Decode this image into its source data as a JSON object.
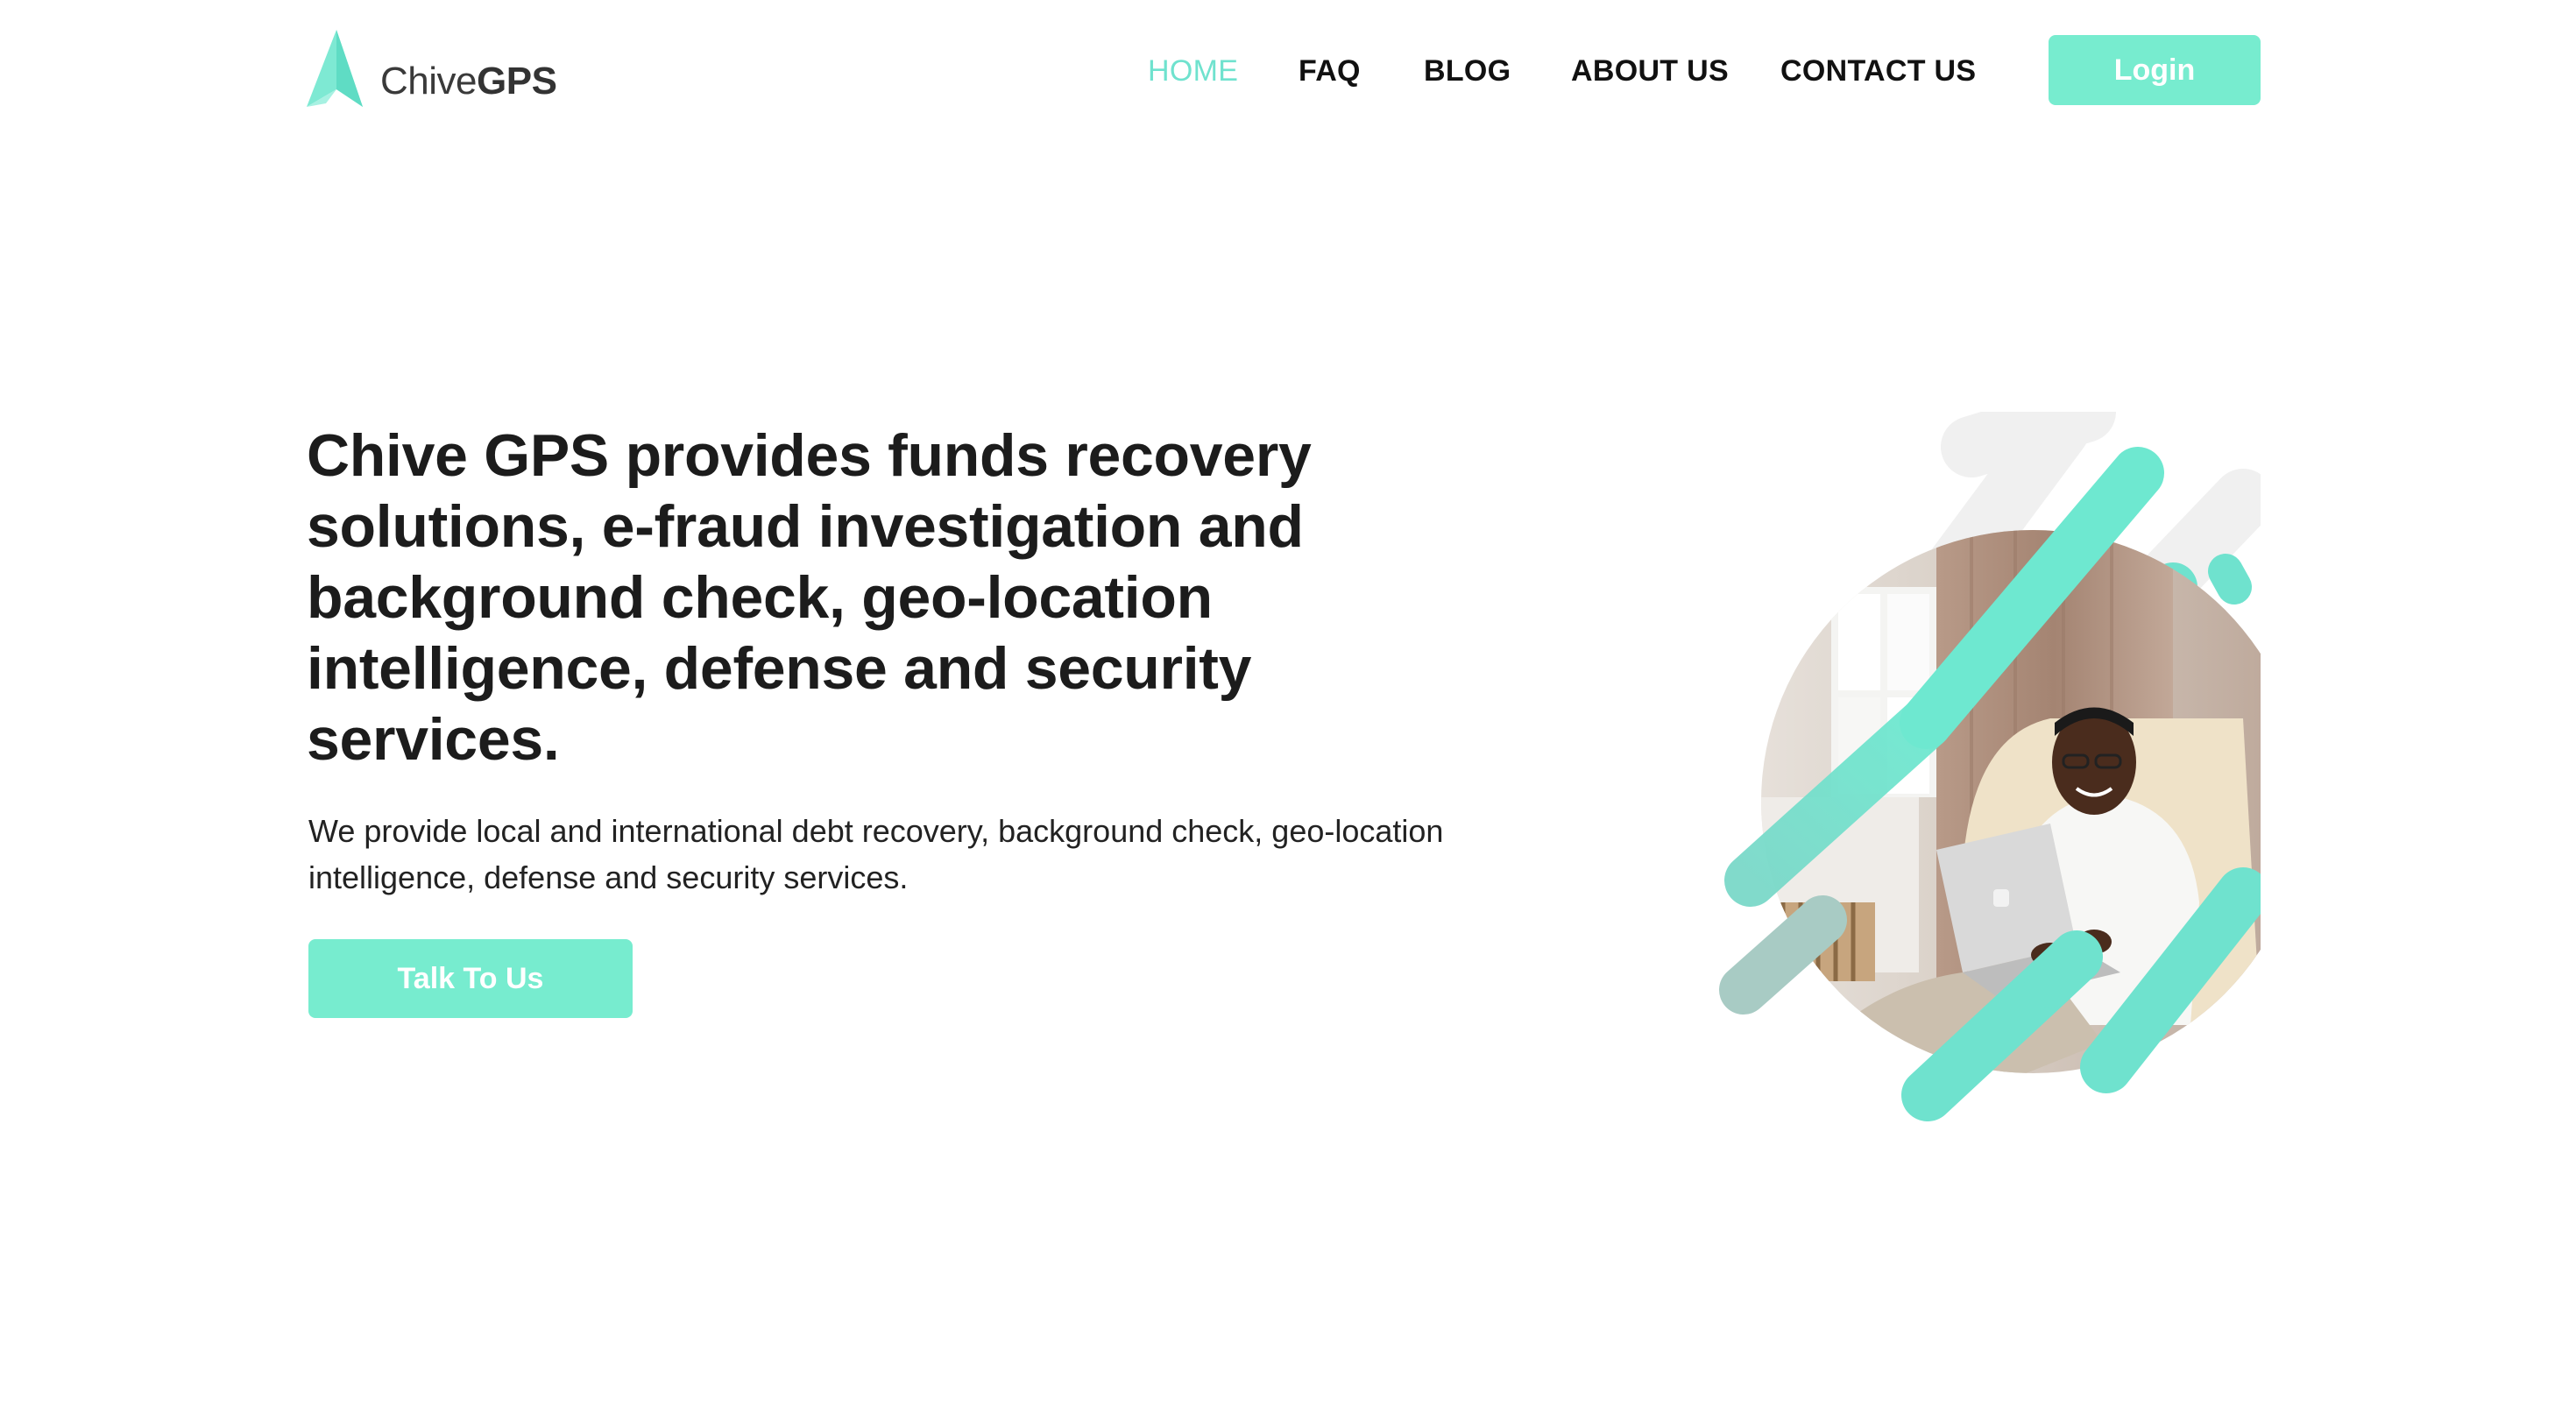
{
  "header": {
    "logo": {
      "text_light": "Chive",
      "text_bold": "GPS"
    },
    "nav": {
      "home": "HOME",
      "faq": "FAQ",
      "blog": "BLOG",
      "about": "ABOUT US",
      "contact": "CONTACT US"
    },
    "login_label": "Login"
  },
  "hero": {
    "title": "Chive GPS provides funds recovery solutions, e-fraud investigation and background check, geo-location intelligence, defense and security services.",
    "description": "We provide local and international debt recovery, background check, geo-location intelligence, defense and security services.",
    "cta_label": "Talk To Us",
    "image_subject": "man-with-laptop"
  },
  "colors": {
    "accent": "#6fe2ce",
    "button": "#77eccf",
    "text": "#1c1c1c",
    "background": "#ffffff"
  }
}
